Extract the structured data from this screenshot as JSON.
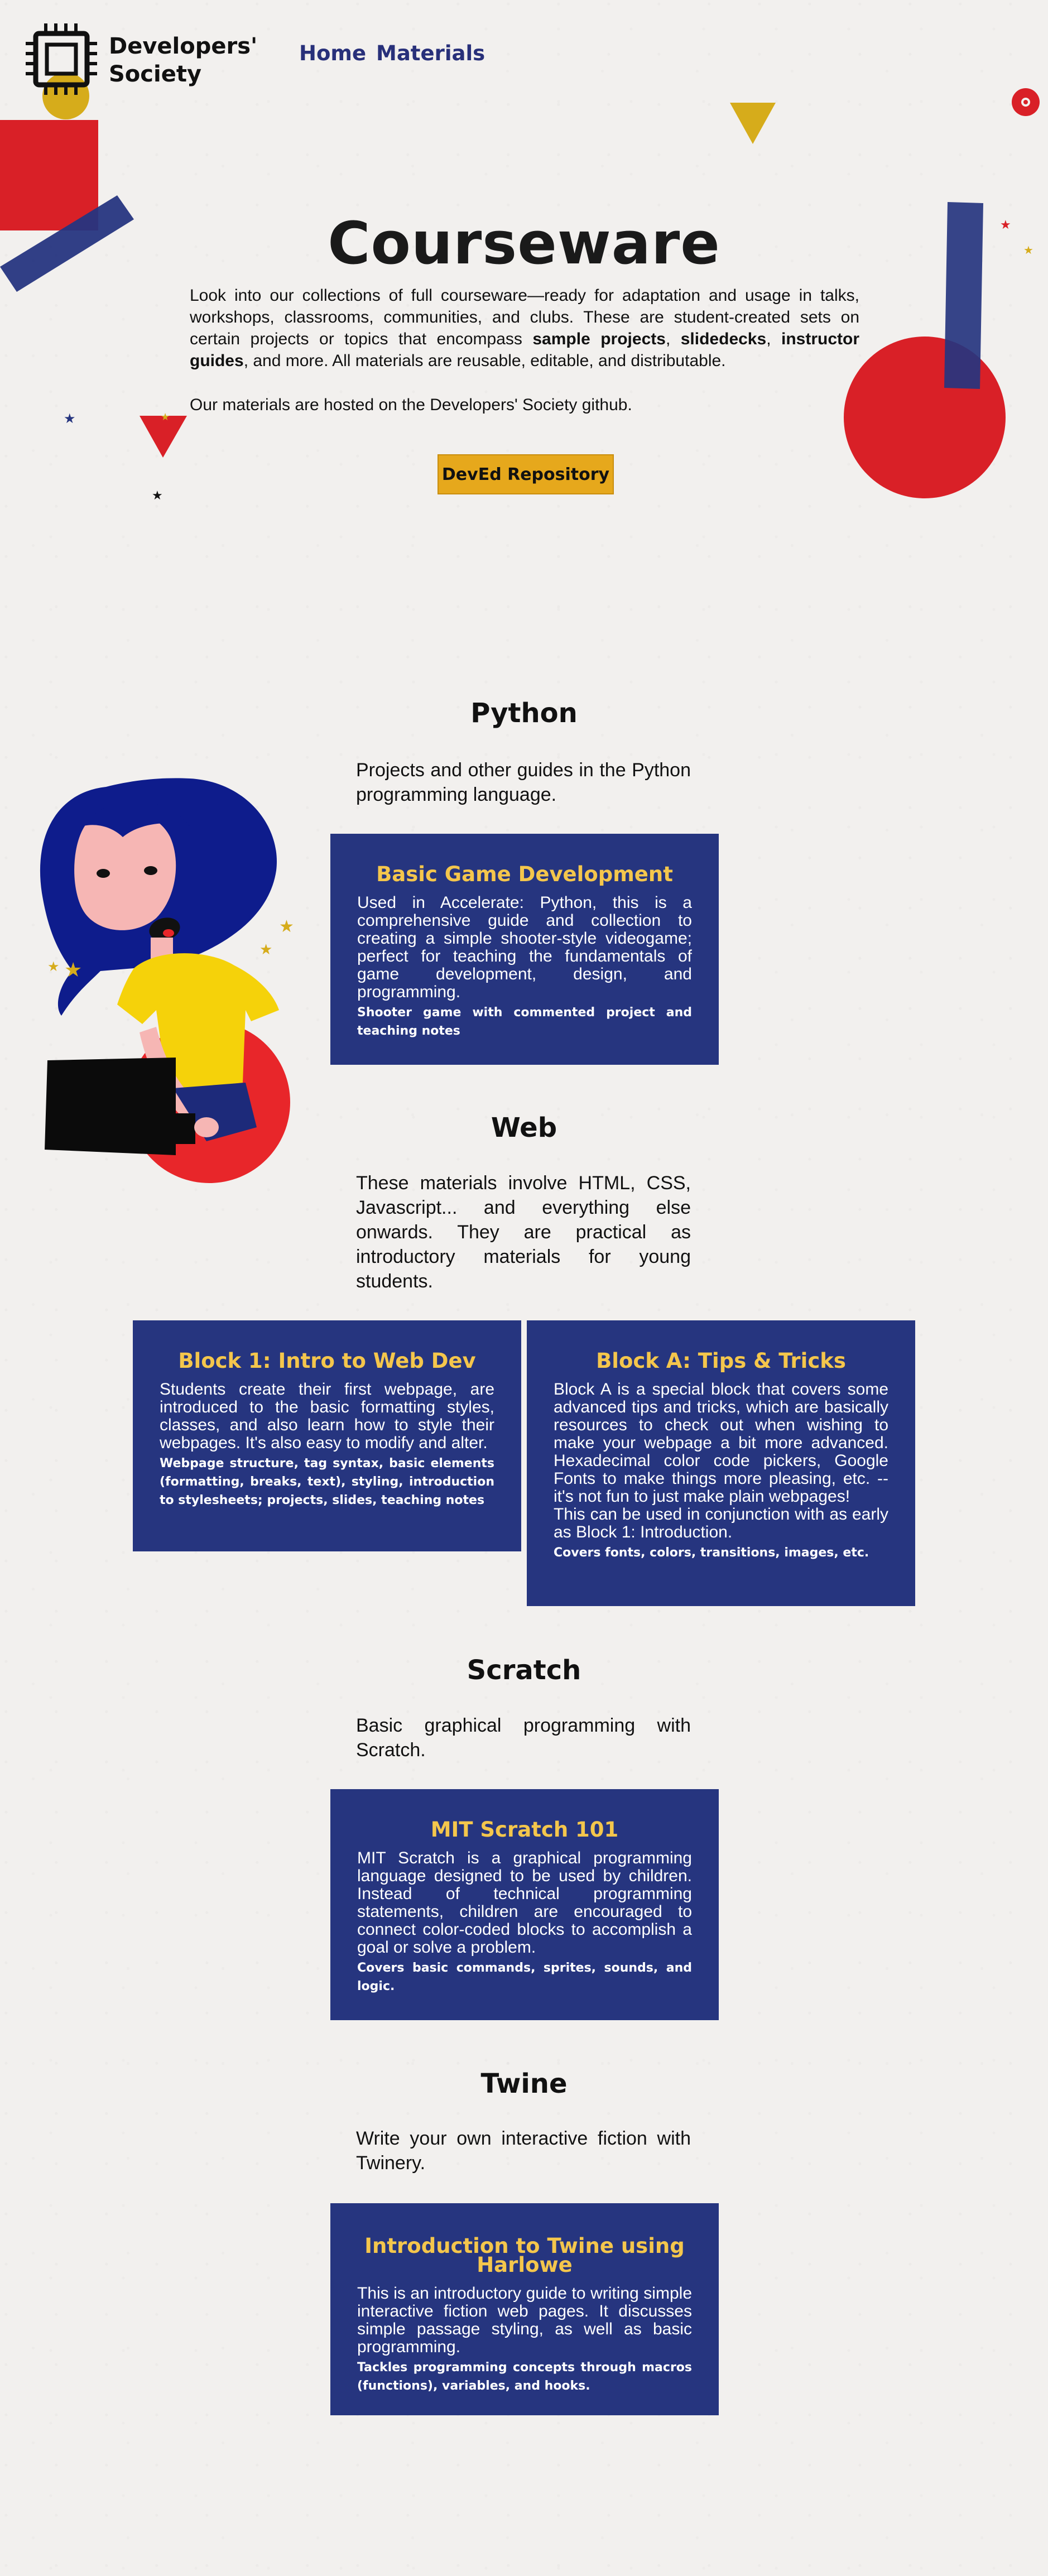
{
  "header": {
    "logo_alt": "Developers' Society",
    "logo_line1": "Developers'",
    "logo_line2": "Society",
    "nav": [
      {
        "label": "Home"
      },
      {
        "label": "Materials"
      }
    ]
  },
  "hero": {
    "title": "Courseware",
    "intro_part1": "Look into our collections of full courseware—ready for adaptation and usage in talks, workshops, classrooms, communities, and clubs. These are student-created sets on certain projects or topics that encompass ",
    "intro_bold1": "sample projects",
    "intro_sep1": ", ",
    "intro_bold2": "slidedecks",
    "intro_sep2": ", ",
    "intro_bold3": "instructor guides",
    "intro_part2": ", and more. All materials are reusable, editable, and distributable.",
    "hosted": "Our materials are hosted on the Developers' Society github.",
    "repo_button": "DevEd Repository"
  },
  "sections": [
    {
      "title": "Python",
      "description": "Projects and other guides in the Python programming language.",
      "cards": [
        {
          "title": "Basic Game Development",
          "body": "Used in Accelerate: Python, this is a comprehensive guide and collection to creating a simple shooter-style videogame; perfect for teaching the fundamentals of game development, design, and programming.",
          "footer": "Shooter game with commented project and teaching notes"
        }
      ]
    },
    {
      "title": "Web",
      "description": "These materials involve HTML, CSS, Javascript... and everything else onwards. They are practical as introductory materials for young students.",
      "cards": [
        {
          "title": "Block 1: Intro to Web Dev",
          "body": "Students create their first webpage, are introduced to the basic formatting styles, classes, and also learn how to style their webpages. It's also easy to modify and alter.",
          "footer": "Webpage structure, tag syntax, basic elements (formatting, breaks, text), styling, introduction to stylesheets; projects, slides, teaching notes"
        },
        {
          "title": "Block A: Tips & Tricks",
          "body": "Block A is a special block that covers some advanced tips and tricks, which are basically resources to check out when wishing to make your webpage a bit more advanced. Hexadecimal color code pickers, Google Fonts to make things more pleasing, etc. -- it's not fun to just make plain webpages!",
          "body2": "This can be used in conjunction with as early as Block 1: Introduction.",
          "footer": "Covers fonts, colors, transitions, images, etc."
        }
      ]
    },
    {
      "title": "Scratch",
      "description": "Basic graphical programming with Scratch.",
      "cards": [
        {
          "title": "MIT Scratch 101",
          "body": "MIT Scratch is a graphical programming language designed to be used by children. Instead of technical programming statements, children are encouraged to connect color-coded blocks to accomplish a goal or solve a problem.",
          "footer": "Covers basic commands, sprites, sounds, and logic."
        }
      ]
    },
    {
      "title": "Twine",
      "description": "Write your own interactive fiction with Twinery.",
      "cards": [
        {
          "title": "Introduction to Twine using Harlowe",
          "body": "This is an introductory guide to writing simple interactive fiction web pages. It discusses simple passage styling, as well as basic programming.",
          "footer": "Tackles programming concepts through macros (functions), variables, and hooks."
        }
      ]
    }
  ],
  "colors": {
    "navy": "#26357f",
    "card_title": "#f4c64c",
    "red": "#d92027",
    "yellow": "#d6ac1b",
    "button": "#e6a81c",
    "background": "#f2f0ee"
  },
  "icons": {
    "logo": "cpu-chip-icon"
  }
}
